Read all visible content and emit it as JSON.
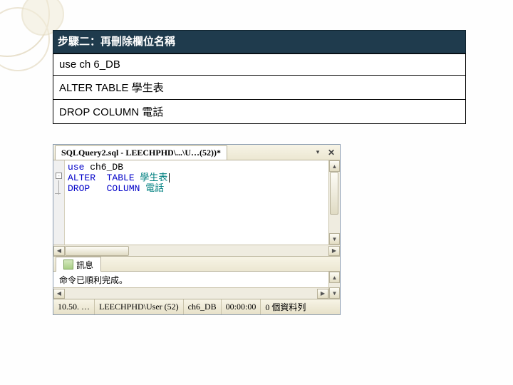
{
  "step": {
    "title": "步驟二：再刪除欄位名稱"
  },
  "sql": {
    "line1": "use ch 6_DB",
    "line2": "ALTER  TABLE  學生表",
    "line3": "DROP   COLUMN 電話"
  },
  "ssms": {
    "tab_title": "SQLQuery2.sql - LEECHPHD\\...\\U…(52))*",
    "editor": {
      "l1_kw": "use",
      "l1_rest": " ch6_DB",
      "l2_kw": "ALTER  TABLE",
      "l2_ident": " 學生表",
      "l3_kw": "DROP   COLUMN",
      "l3_ident": " 電話"
    },
    "messages_tab": "訊息",
    "message_text": "命令已順利完成。",
    "status": {
      "cell1": "10.50. …",
      "cell2": "LEECHPHD\\User (52)",
      "cell3": "ch6_DB",
      "cell4": "00:00:00",
      "cell5": "0 個資料列"
    }
  }
}
